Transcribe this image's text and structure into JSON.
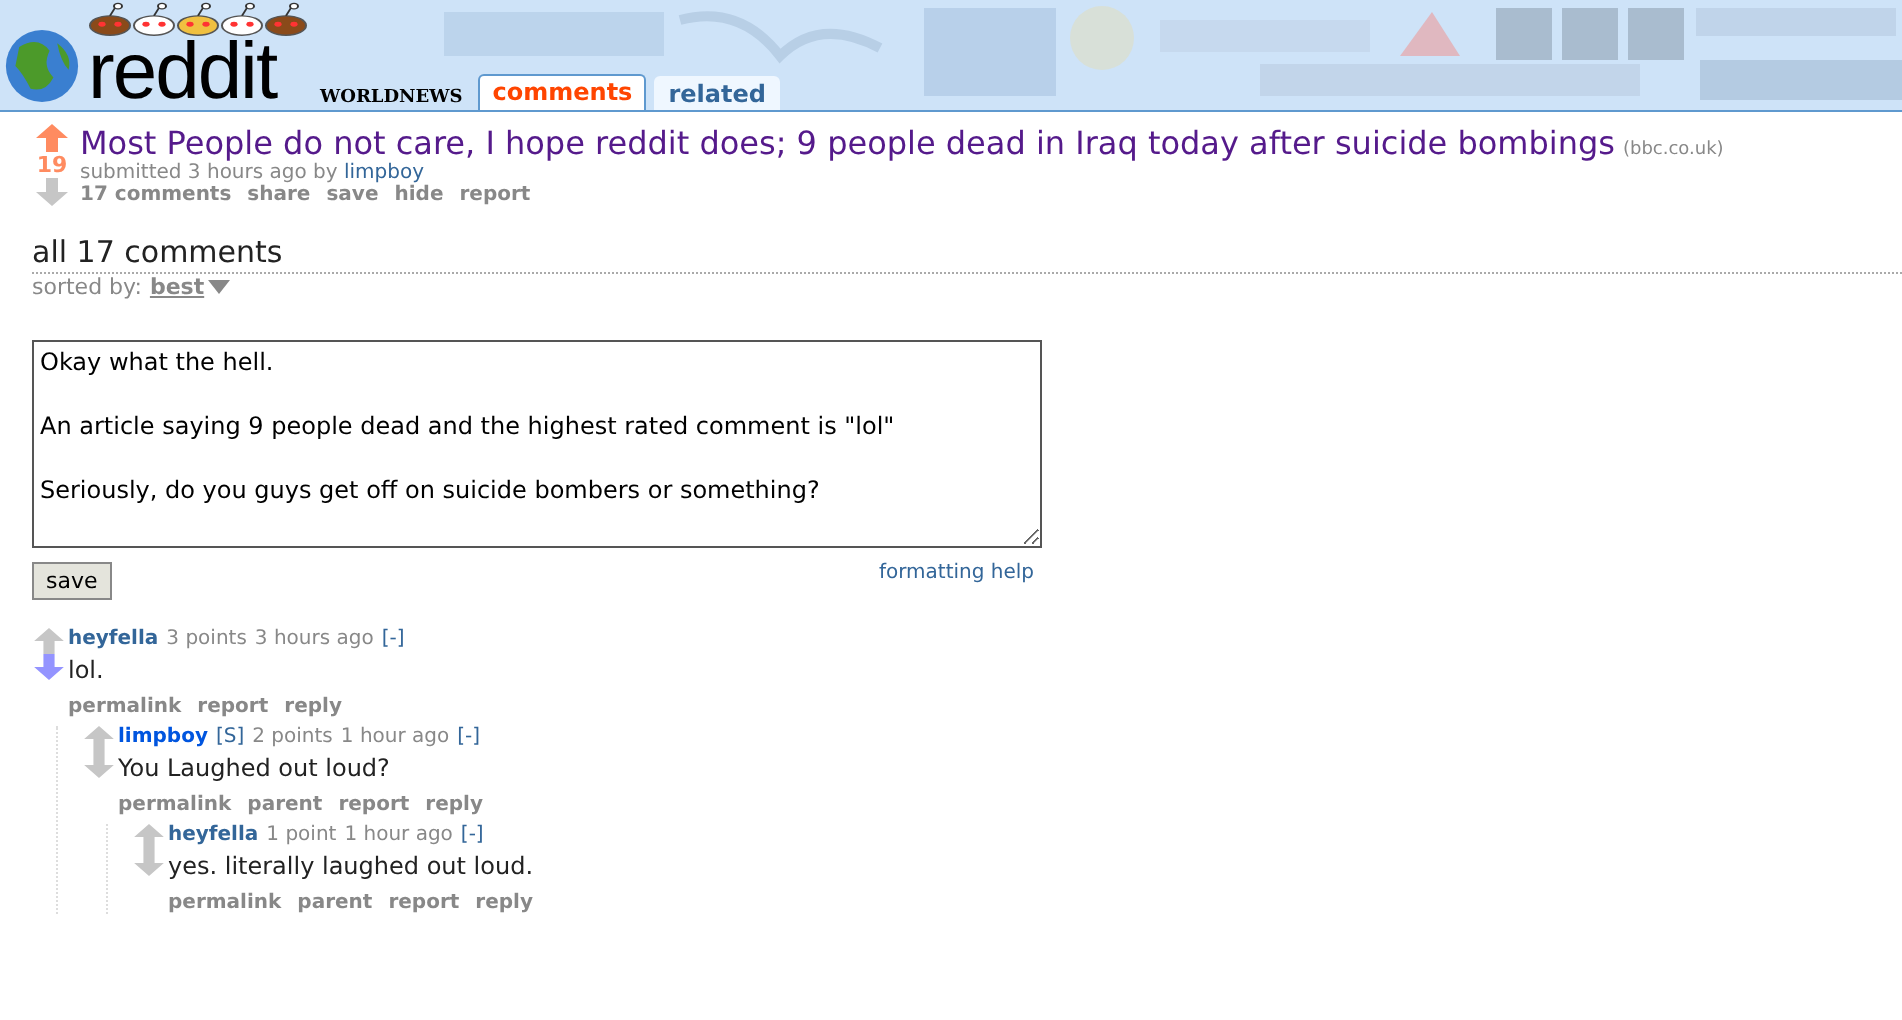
{
  "header": {
    "logo": "reddit",
    "subreddit": "WORLDNEWS",
    "tabs": [
      {
        "label": "comments",
        "selected": true
      },
      {
        "label": "related",
        "selected": false
      }
    ]
  },
  "post": {
    "upvoted": true,
    "downvoted": false,
    "score": "19",
    "title": "Most People do not care, I hope reddit does; 9 people dead in Iraq today after suicide bombings",
    "domain": "(bbc.co.uk)",
    "submitted": "submitted 3 hours ago by",
    "author": "limpboy",
    "actions": [
      "17 comments",
      "share",
      "save",
      "hide",
      "report"
    ]
  },
  "comments_heading": "all 17 comments",
  "sort": {
    "label": "sorted by:",
    "value": "best"
  },
  "reply_box": {
    "value": "Okay what the hell.\n\nAn article saying 9 people dead and the highest rated comment is \"lol\"\n\nSeriously, do you guys get off on suicide bombers or something?",
    "save": "save",
    "help": "formatting help"
  },
  "comments": [
    {
      "author": "heyfella",
      "points": "3 points",
      "age": "3 hours ago",
      "collapse": "[-]",
      "upvoted": false,
      "downvoted": true,
      "body": "lol.",
      "actions": [
        "permalink",
        "report",
        "reply"
      ],
      "children": [
        {
          "author": "limpboy",
          "submitter_tag": "[S]",
          "points": "2 points",
          "age": "1 hour ago",
          "collapse": "[-]",
          "upvoted": false,
          "downvoted": false,
          "body": "You Laughed out loud?",
          "actions": [
            "permalink",
            "parent",
            "report",
            "reply"
          ],
          "children": [
            {
              "author": "heyfella",
              "points": "1 point",
              "age": "1 hour ago",
              "collapse": "[-]",
              "upvoted": false,
              "downvoted": false,
              "body": "yes. literally laughed out loud.",
              "actions": [
                "permalink",
                "parent",
                "report",
                "reply"
              ]
            }
          ]
        }
      ]
    }
  ]
}
